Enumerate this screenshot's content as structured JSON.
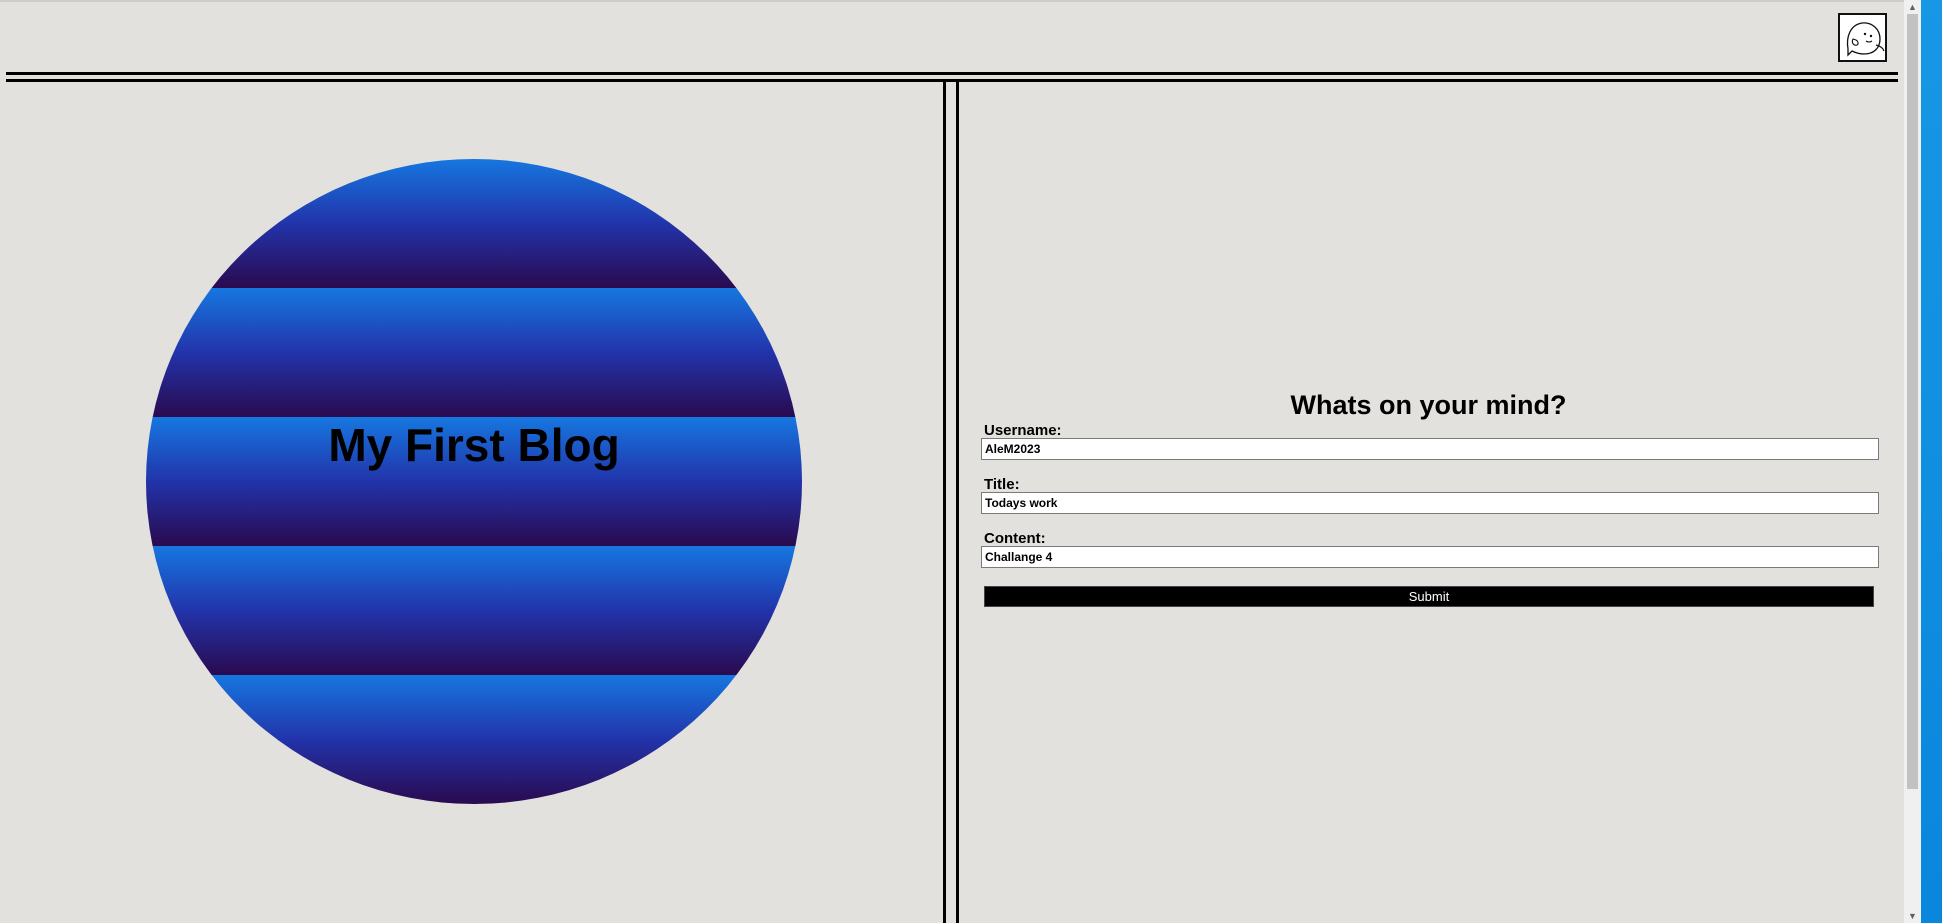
{
  "header": {
    "logo_icon": "ghost-icon"
  },
  "blog": {
    "title": "My First Blog",
    "gradient_colors": [
      "#1677e0",
      "#2233aa",
      "#2a0a4f"
    ]
  },
  "form": {
    "heading": "Whats on your mind?",
    "username_label": "Username:",
    "username_value": "AleM2023",
    "title_label": "Title:",
    "title_value": "Todays work",
    "content_label": "Content:",
    "content_value": "Challange 4",
    "submit_label": "Submit"
  },
  "scrollbar": {
    "up_icon": "chevron-up-icon",
    "down_icon": "chevron-down-icon"
  }
}
